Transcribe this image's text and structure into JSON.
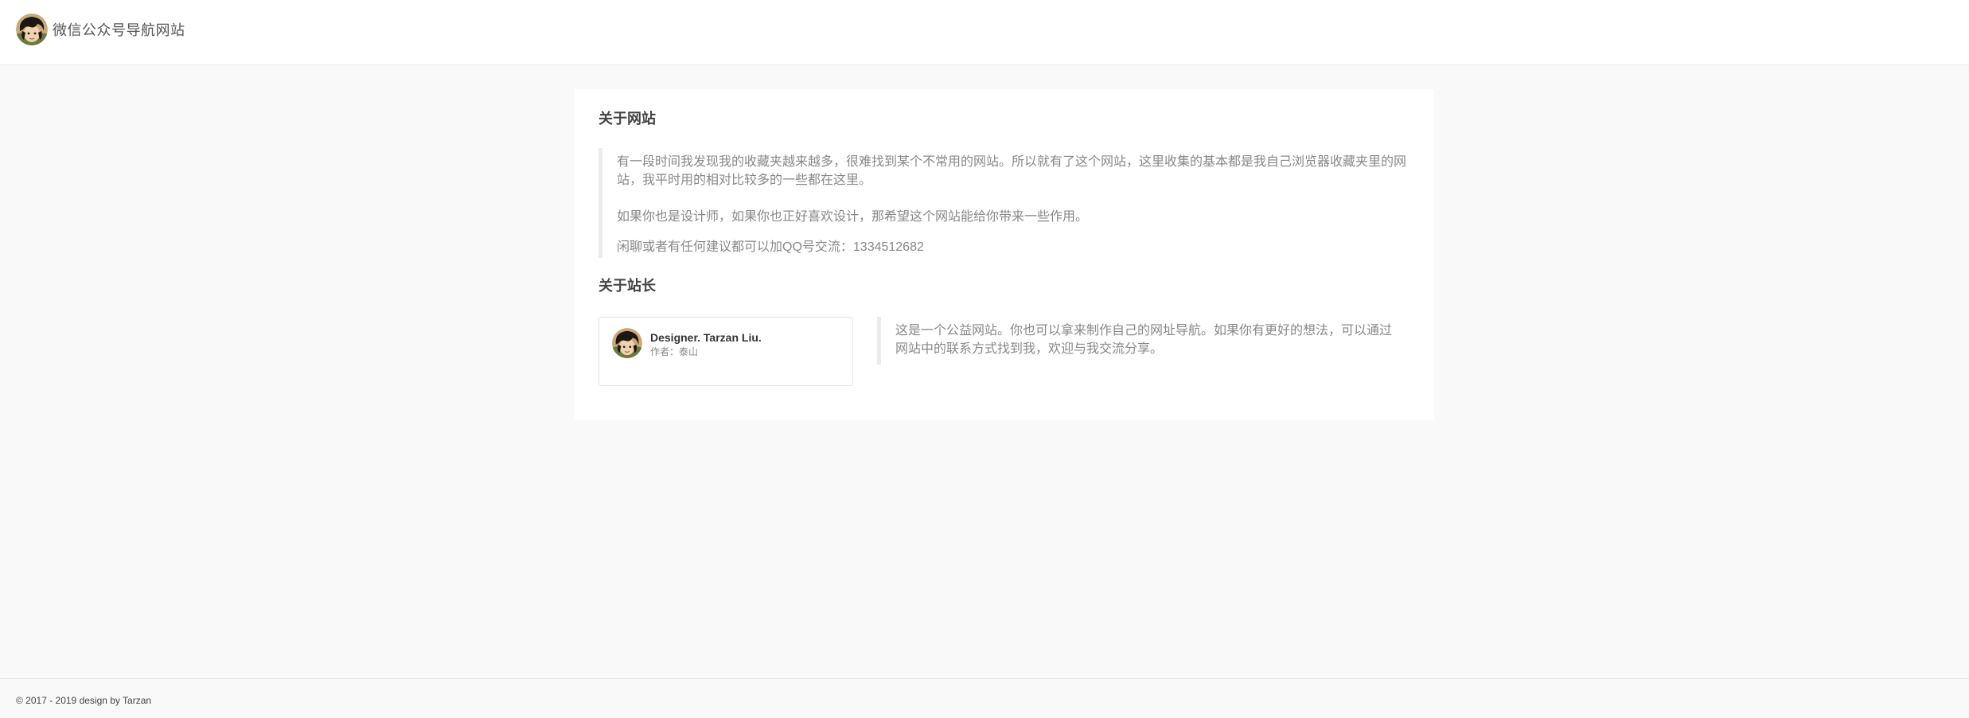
{
  "header": {
    "site_title": "微信公众号导航网站",
    "logo_icon": "avatar-icon"
  },
  "about_site": {
    "title": "关于网站",
    "paragraphs": [
      "有一段时间我发现我的收藏夹越来越多，很难找到某个不常用的网站。所以就有了这个网站，这里收集的基本都是我自己浏览器收藏夹里的网站，我平时用的相对比较多的一些都在这里。",
      "如果你也是设计师，如果你也正好喜欢设计，那希望这个网站能给你带来一些作用。",
      "闲聊或者有任何建议都可以加QQ号交流：1334512682"
    ]
  },
  "about_owner": {
    "title": "关于站长",
    "name": "Designer. Tarzan Liu.",
    "subtitle": "作者：泰山",
    "description": "这是一个公益网站。你也可以拿来制作自己的网址导航。如果你有更好的想法，可以通过网站中的联系方式找到我，欢迎与我交流分享。"
  },
  "footer": {
    "copyright": "© 2017 - 2019 design by Tarzan"
  },
  "colors": {
    "page_bg": "#f9f9f9",
    "card_bg": "#ffffff",
    "quote_border": "#ececec",
    "muted_text": "#888888"
  }
}
